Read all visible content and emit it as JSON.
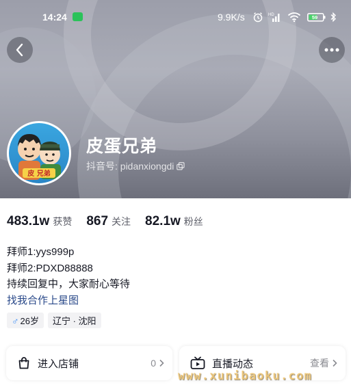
{
  "status_bar": {
    "time": "14:24",
    "network_speed": "9.9K/s",
    "battery": "59",
    "icons": [
      "wechat-icon",
      "alarm-icon",
      "hd-icon",
      "signal-icon",
      "wifi-icon",
      "battery-icon",
      "bluetooth-icon"
    ]
  },
  "header": {
    "back_icon": "chevron-left-icon",
    "more_icon": "more-dots-icon"
  },
  "profile": {
    "name": "皮蛋兄弟",
    "douyin_id": "抖音号: pidanxiongdi",
    "avatar_text": "皮 兄弟"
  },
  "stats": [
    {
      "value": "483.1w",
      "label": "获赞"
    },
    {
      "value": "867",
      "label": "关注"
    },
    {
      "value": "82.1w",
      "label": "粉丝"
    }
  ],
  "bio": {
    "lines": [
      "拜师1:yys999p",
      "拜师2:PDXD88888",
      "持续回复中，大家耐心等待"
    ],
    "link": "找我合作上星图"
  },
  "tags": {
    "age": "26岁",
    "location": "辽宁 · 沈阳"
  },
  "cards": {
    "shop": {
      "label": "进入店铺",
      "count": "0"
    },
    "live": {
      "label": "直播动态",
      "aux": "查看"
    }
  },
  "watermark": "www.xunibaoku.com",
  "colors": {
    "link": "#2b4a8a",
    "male": "#3e8ef7",
    "header": "#9c9eaa"
  }
}
